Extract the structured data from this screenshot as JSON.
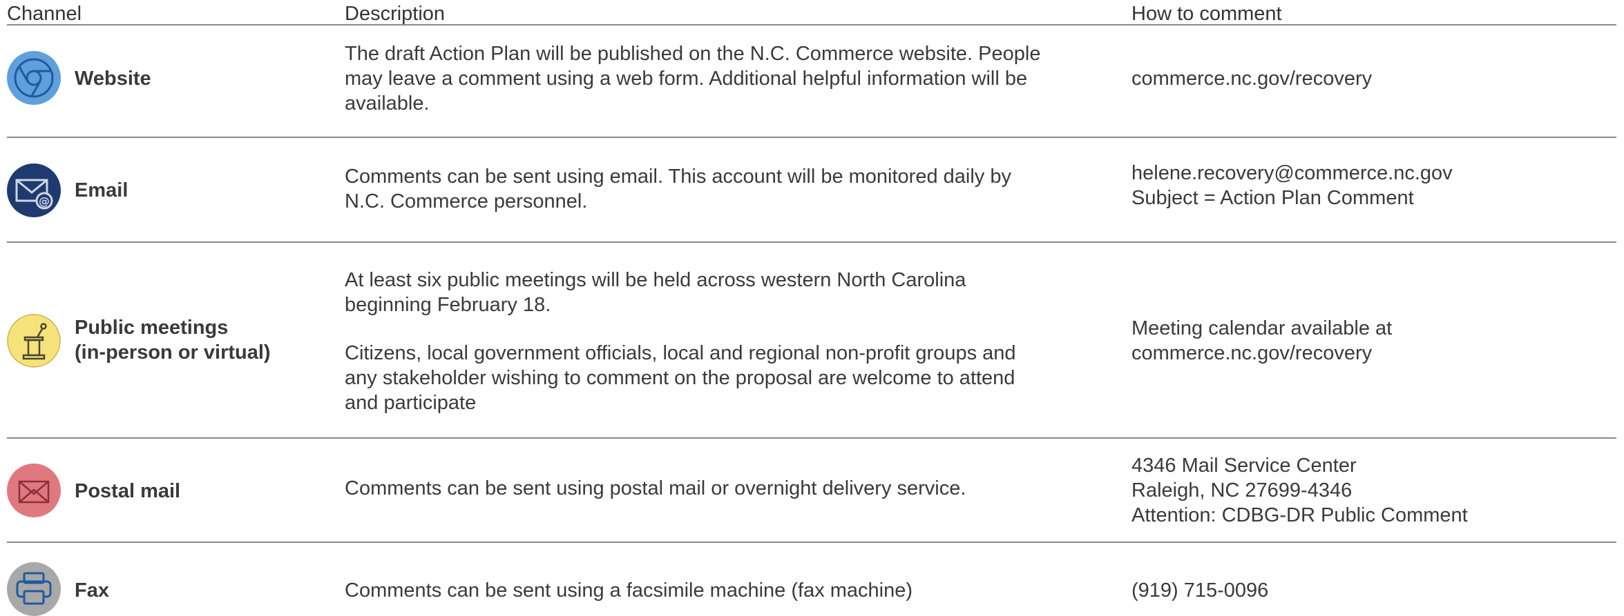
{
  "headers": {
    "channel": "Channel",
    "description": "Description",
    "how": "How to comment"
  },
  "rows": [
    {
      "icon": "chrome-icon",
      "color": "#5f9fdc",
      "channel": [
        "Website"
      ],
      "description": [
        "The draft Action Plan will be published on the N.C. Commerce website.  People",
        "may leave a comment using a web form.  Additional helpful information will be",
        "available."
      ],
      "how": [
        "commerce.nc.gov/recovery"
      ]
    },
    {
      "icon": "email-icon",
      "color": "#1f3a6e",
      "channel": [
        "Email"
      ],
      "description": [
        "Comments can be sent using email.  This account will be monitored daily by",
        "N.C. Commerce personnel."
      ],
      "how": [
        "helene.recovery@commerce.nc.gov",
        "Subject = Action Plan Comment"
      ]
    },
    {
      "icon": "podium-icon",
      "color": "#f5e27a",
      "channel": [
        "Public meetings",
        "(in-person or virtual)"
      ],
      "description_para1": [
        "At least six public meetings will be held across western North Carolina",
        "beginning February 18."
      ],
      "description_para2": [
        "Citizens, local government officials, local and regional non-profit groups and",
        "any stakeholder wishing to comment on the proposal are welcome to attend",
        "and participate"
      ],
      "how": [
        "Meeting calendar available at",
        "commerce.nc.gov/recovery"
      ]
    },
    {
      "icon": "envelope-icon",
      "color": "#e07880",
      "channel": [
        "Postal mail"
      ],
      "description": [
        "Comments can be sent using postal mail or overnight delivery service."
      ],
      "how": [
        "4346 Mail Service Center",
        "Raleigh, NC 27699-4346",
        "Attention: CDBG-DR Public Comment"
      ]
    },
    {
      "icon": "printer-icon",
      "color": "#a8a8a8",
      "channel": [
        "Fax"
      ],
      "description": [
        "Comments can be sent using a facsimile machine (fax machine)"
      ],
      "how": [
        "(919) 715-0096"
      ]
    }
  ]
}
